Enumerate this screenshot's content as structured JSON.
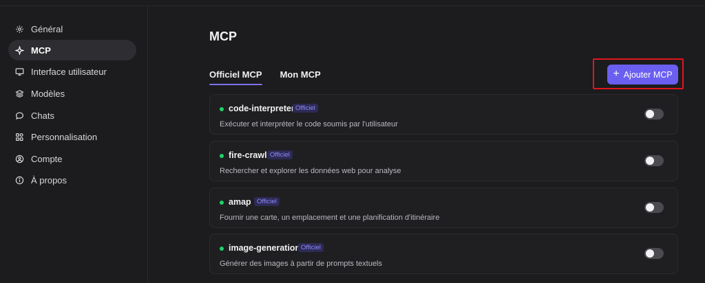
{
  "sidebar": {
    "items": [
      {
        "label": "Général",
        "icon": "gear-icon"
      },
      {
        "label": "MCP",
        "icon": "sparkle-icon",
        "active": true
      },
      {
        "label": "Interface utilisateur",
        "icon": "monitor-icon"
      },
      {
        "label": "Modèles",
        "icon": "layers-icon"
      },
      {
        "label": "Chats",
        "icon": "chat-icon"
      },
      {
        "label": "Personnalisation",
        "icon": "grid-icon"
      },
      {
        "label": "Compte",
        "icon": "user-circle-icon"
      },
      {
        "label": "À propos",
        "icon": "info-icon"
      }
    ]
  },
  "main": {
    "title": "MCP",
    "tabs": [
      {
        "label": "Officiel MCP",
        "active": true
      },
      {
        "label": "Mon MCP"
      }
    ],
    "add_button": {
      "label": "Ajouter MCP",
      "icon": "plus-icon"
    },
    "cards": [
      {
        "name": "code-interpreter",
        "badge": "Officiel",
        "description": "Exécuter et interpréter le code soumis par l'utilisateur",
        "enabled": false
      },
      {
        "name": "fire-crawl",
        "badge": "Officiel",
        "description": "Rechercher et explorer les données web pour analyse",
        "enabled": false
      },
      {
        "name": "amap",
        "badge": "Officiel",
        "description": "Fournir une carte, un emplacement et une planification d'itinéraire",
        "enabled": false
      },
      {
        "name": "image-generation",
        "badge": "Officiel",
        "description": "Générer des images à partir de prompts textuels",
        "enabled": false
      }
    ]
  },
  "colors": {
    "accent": "#6a5ff0",
    "status_green": "#1fd36b",
    "highlight": "#e0161b",
    "badge_text": "#8f8cff"
  }
}
